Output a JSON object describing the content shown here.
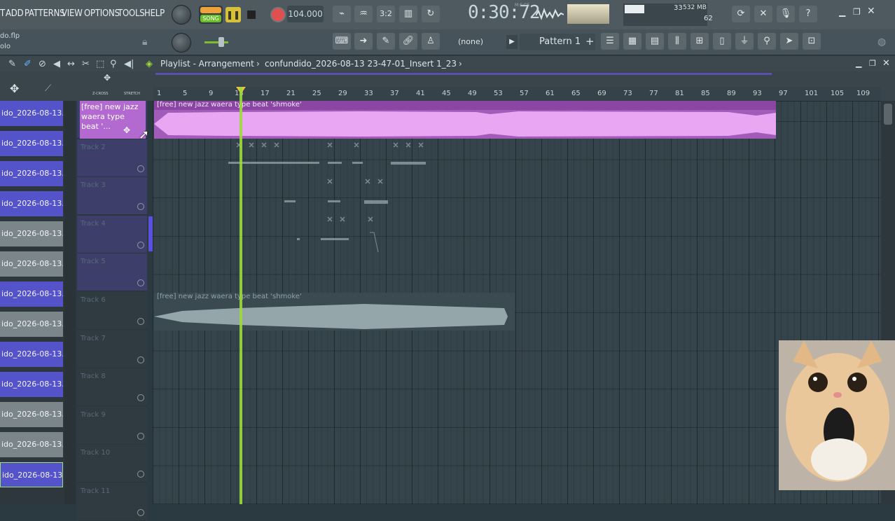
{
  "menu": [
    "T",
    "ADD",
    "PATTERNS",
    "VIEW",
    "OPTIONS",
    "TOOLS",
    "HELP"
  ],
  "transport": {
    "mode": "SONG",
    "tempo": "104.000",
    "time": "0:30:72",
    "time_unit": "M:S:CS"
  },
  "meters": {
    "cpu": "33",
    "memory": "532 MB",
    "voices": "62"
  },
  "project": {
    "file": "do.flp",
    "sub": "olo"
  },
  "pattern_select": {
    "none_label": "(none)",
    "pattern": "Pattern 1"
  },
  "playlist": {
    "title": "Playlist - Arrangement",
    "breadcrumb": "confundido_2026-08-13 23-47-01_Insert 1_23"
  },
  "ruler_ticks": [
    "1",
    "5",
    "9",
    "13",
    "17",
    "21",
    "25",
    "29",
    "33",
    "37",
    "41",
    "45",
    "49",
    "53",
    "57",
    "61",
    "65",
    "69",
    "73",
    "77",
    "81",
    "85",
    "89",
    "93",
    "97",
    "101",
    "105",
    "109"
  ],
  "patterns_list": [
    {
      "label": "ido_2026-08-13...",
      "color": "blue"
    },
    {
      "label": "ido_2026-08-13...",
      "color": "blue"
    },
    {
      "label": "ido_2026-08-13...",
      "color": "blue"
    },
    {
      "label": "ido_2026-08-13...",
      "color": "blue"
    },
    {
      "label": "ido_2026-08-13...",
      "color": "gray"
    },
    {
      "label": "ido_2026-08-13...",
      "color": "gray"
    },
    {
      "label": "ido_2026-08-13...",
      "color": "blue"
    },
    {
      "label": "ido_2026-08-13...",
      "color": "gray"
    },
    {
      "label": "ido_2026-08-13...",
      "color": "blue"
    },
    {
      "label": "ido_2026-08-13...",
      "color": "blue"
    },
    {
      "label": "ido_2026-08-13...",
      "color": "gray"
    },
    {
      "label": "ido_2026-08-13...",
      "color": "gray"
    },
    {
      "label": "ido_2026-08-13...",
      "color": "blue"
    }
  ],
  "tracks": [
    {
      "name": "[free] new jazz waera type beat '..."
    },
    {
      "name": "Track 2"
    },
    {
      "name": "Track 3"
    },
    {
      "name": "Track 4"
    },
    {
      "name": "Track 5"
    },
    {
      "name": "Track 6"
    },
    {
      "name": "Track 7"
    },
    {
      "name": "Track 8"
    },
    {
      "name": "Track 9"
    },
    {
      "name": "Track 10"
    },
    {
      "name": "Track 11"
    }
  ],
  "clips": {
    "track1": "[free] new jazz  waera type beat  'shmoke'",
    "track6": "[free] new jazz  waera type beat  'shmoke'"
  },
  "toolbar_labels": {
    "z_cross": "Z-CROSS",
    "stretch": "STRETCH"
  },
  "colors": {
    "accent_green": "#9ddc3a",
    "clip_pink": "#c77bd8",
    "pattern_blue": "#5453c9"
  }
}
